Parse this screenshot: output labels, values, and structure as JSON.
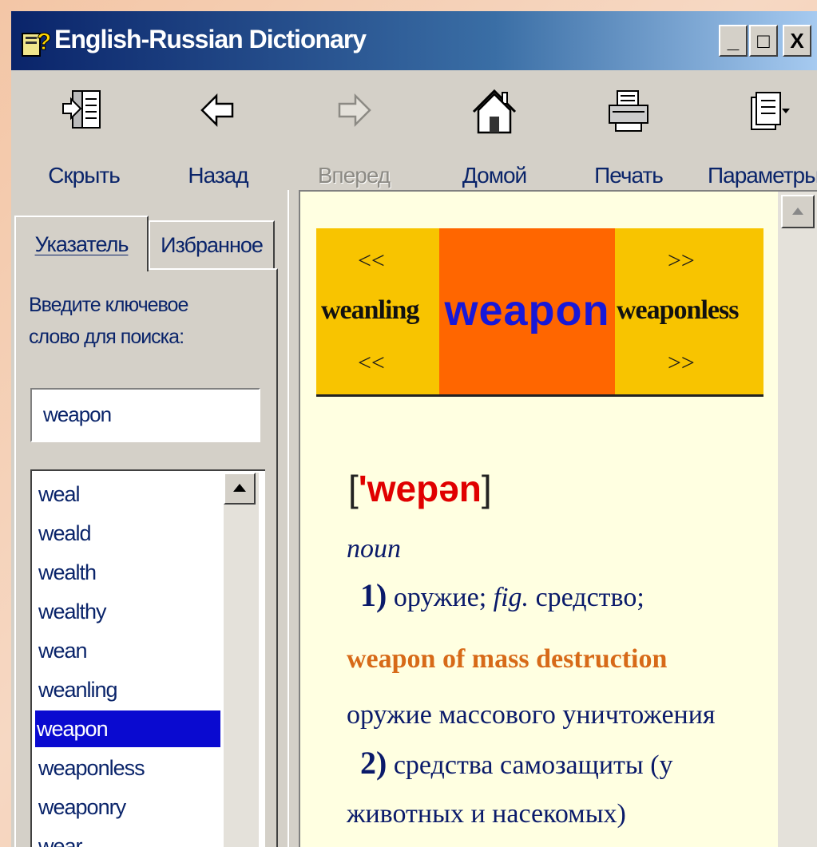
{
  "window": {
    "title": "English-Russian Dictionary",
    "controls": {
      "minimize": "_",
      "maximize": "□",
      "close": "X"
    }
  },
  "toolbar": [
    {
      "label": "Скрыть",
      "icon": "hide-icon",
      "enabled": true
    },
    {
      "label": "Назад",
      "icon": "back-arrow-icon",
      "enabled": true
    },
    {
      "label": "Вперед",
      "icon": "forward-arrow-icon",
      "enabled": false
    },
    {
      "label": "Домой",
      "icon": "home-icon",
      "enabled": true
    },
    {
      "label": "Печать",
      "icon": "printer-icon",
      "enabled": true
    },
    {
      "label": "Параметры",
      "icon": "options-icon",
      "enabled": true
    }
  ],
  "sidebar": {
    "tabs": [
      {
        "label": "Указатель",
        "active": true
      },
      {
        "label": "Избранное",
        "active": false
      }
    ],
    "prompt_line1": "Введите ключевое",
    "prompt_line2": "слово для поиска:",
    "search_value": "weapon",
    "words": [
      "weal",
      "weald",
      "wealth",
      "wealthy",
      "wean",
      "weanling",
      "weapon",
      "weaponless",
      "weaponry",
      "wear"
    ],
    "selected_word": "weapon"
  },
  "entry": {
    "prev_word": "weanling",
    "headword": "weapon",
    "next_word": "weaponless",
    "prev_arrow": "<<",
    "next_arrow": ">>",
    "transcription_open": "[",
    "transcription": "'wepən",
    "transcription_close": "]",
    "part_of_speech": "noun",
    "sense1_num": "1)",
    "sense1_text": "оружие;",
    "sense1_fig": "fig.",
    "sense1_text2": "средство;",
    "phrase": "weapon of mass destruction",
    "phrase_translation": "оружие массового уничтожения",
    "sense2_num": "2)",
    "sense2_text_line1": "средства самозащиты (у",
    "sense2_text_line2": "животных и насекомых)"
  },
  "colors": {
    "title_bar": "#0a246a",
    "banner_yellow": "#f8c400",
    "banner_orange": "#ff6600",
    "headword_blue": "#1818d8",
    "transcription_red": "#e00000",
    "phrase_orange": "#d76a18",
    "content_bg": "#ffffe1",
    "selection_blue": "#0a0ad0"
  }
}
